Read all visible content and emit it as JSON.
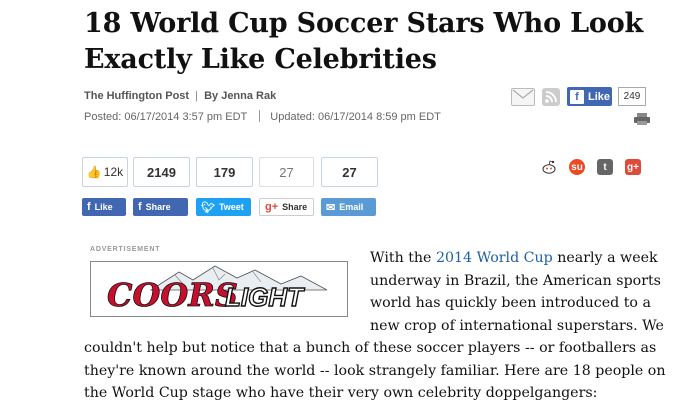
{
  "headline": "18 World Cup Soccer Stars Who Look Exactly Like Celebrities",
  "byline": {
    "source": "The Huffington Post",
    "separator": "|",
    "author": "By Jenna Rak"
  },
  "dates": {
    "posted": "Posted: 06/17/2014 3:57 pm EDT",
    "updated": "Updated: 06/17/2014 8:59 pm EDT"
  },
  "top_share": {
    "like_label": "Like",
    "like_count": "249"
  },
  "share_counts": {
    "facebook": "12k",
    "share": "2149",
    "tweet": "179",
    "google": "27",
    "email": "27"
  },
  "share_buttons": {
    "like": "Like",
    "share": "Share",
    "tweet": "Tweet",
    "google": "Share",
    "email": "Email"
  },
  "ad": {
    "label": "ADVERTISEMENT",
    "brand": "COORS",
    "brand_sub": "LIGHT"
  },
  "article": {
    "intro_before_link": "With the ",
    "link_text": "2014 World Cup",
    "intro_after_link": " nearly a week underway in Brazil, the American sports world has quickly been introduced to a new crop of international superstars. We couldn't help but notice that a bunch of these soccer players -- or footballers as they're known around the world -- look strangely familiar. Here are 18 people on the World Cup stage who have their very own celebrity doppelgangers:"
  },
  "colors": {
    "facebook": "#4267b2",
    "twitter": "#1da1f2",
    "google": "#dd4b39",
    "email": "#5b9bd5",
    "link": "#1d5fa8",
    "coors_red": "#c8102e"
  }
}
